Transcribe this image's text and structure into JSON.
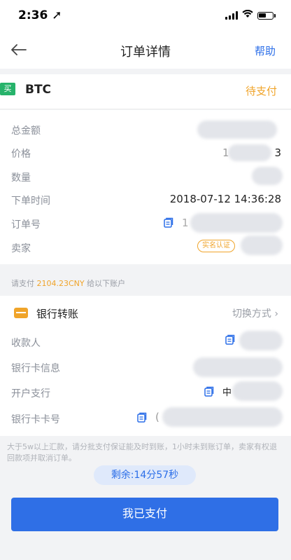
{
  "status_bar": {
    "time": "2:36 ➚"
  },
  "nav": {
    "title": "订单详情",
    "help": "帮助"
  },
  "order": {
    "side_badge": "买",
    "coin": "BTC",
    "status": "待支付",
    "colors": {
      "status": "#f0a42a",
      "badge": "#27b36b",
      "accent": "#2b6ee8"
    }
  },
  "details": {
    "total_label": "总金额",
    "price_label": "价格",
    "price_fragment_left": "1",
    "price_fragment_right": "3",
    "quantity_label": "数量",
    "time_label": "下单时间",
    "time_value": "2018-07-12 14:36:28",
    "order_no_label": "订单号",
    "order_no_fragment": "1",
    "seller_label": "卖家",
    "verified_badge": "实名认证"
  },
  "pay_hint": {
    "prefix": "请支付 ",
    "amount": "2104.23CNY",
    "suffix": " 给以下账户"
  },
  "bank": {
    "title": "银行转账",
    "switch": "切换方式 ›",
    "payee_label": "收款人",
    "card_info_label": "银行卡信息",
    "branch_label": "开户支行",
    "branch_fragment": "中",
    "card_no_label": "银行卡卡号",
    "card_no_fragment": "("
  },
  "notice": "大于5w以上汇款，请分批支付保证能及时到账，1小时未到账订单，卖家有权退回款项并取消订单。",
  "countdown": "剩余:14分57秒",
  "primary_button": "我已支付",
  "icons": [
    "back-arrow-icon",
    "copy-icon",
    "bank-card-icon",
    "signal-icon",
    "wifi-icon",
    "battery-icon"
  ]
}
